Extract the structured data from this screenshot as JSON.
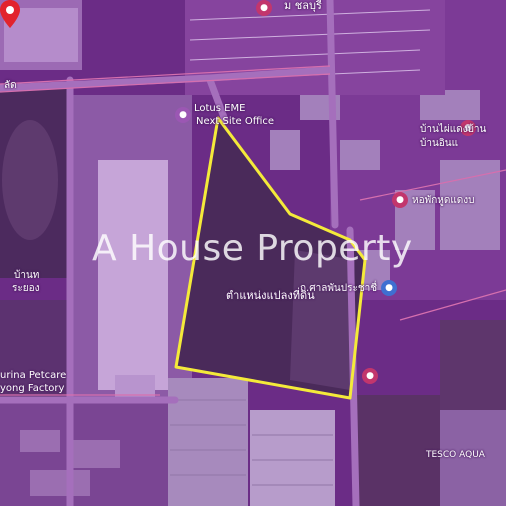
{
  "map": {
    "watermark": "A House Property",
    "parcel_label": "ตำแหน่งแปลงที่ดิน",
    "colors": {
      "overlay": "#7a2f95",
      "parcel_outline": "#f4ea3a",
      "pin": "#e2232d",
      "road": "#9a5fb0",
      "field": "#4d2b5c"
    },
    "labels": [
      {
        "id": "label-top",
        "text": "ม ชลบุรี"
      },
      {
        "id": "label-lotus",
        "text": "Lotus EME"
      },
      {
        "id": "label-lotus-office",
        "text": "Next Site Office"
      },
      {
        "id": "label-right-1",
        "text": "บ้านไผ่แดงบ้าน"
      },
      {
        "id": "label-right-2",
        "text": "บ้านอินแ"
      },
      {
        "id": "label-shop",
        "text": "หอพักหูดแดงบ"
      },
      {
        "id": "label-road",
        "text": "ถ.ศาลพันประชาชื่"
      },
      {
        "id": "label-left-1",
        "text": "บ้านท"
      },
      {
        "id": "label-left-2",
        "text": "ระยอง"
      },
      {
        "id": "label-factory-1",
        "text": "urina Petcare"
      },
      {
        "id": "label-factory-2",
        "text": "yong Factory"
      },
      {
        "id": "label-tesco",
        "text": "TESCO AQUA"
      },
      {
        "id": "label-topleft",
        "text": "ลัด"
      }
    ],
    "poi_icons": [
      "place-icon",
      "place-icon",
      "place-icon",
      "place-icon",
      "place-icon",
      "place-icon"
    ]
  }
}
